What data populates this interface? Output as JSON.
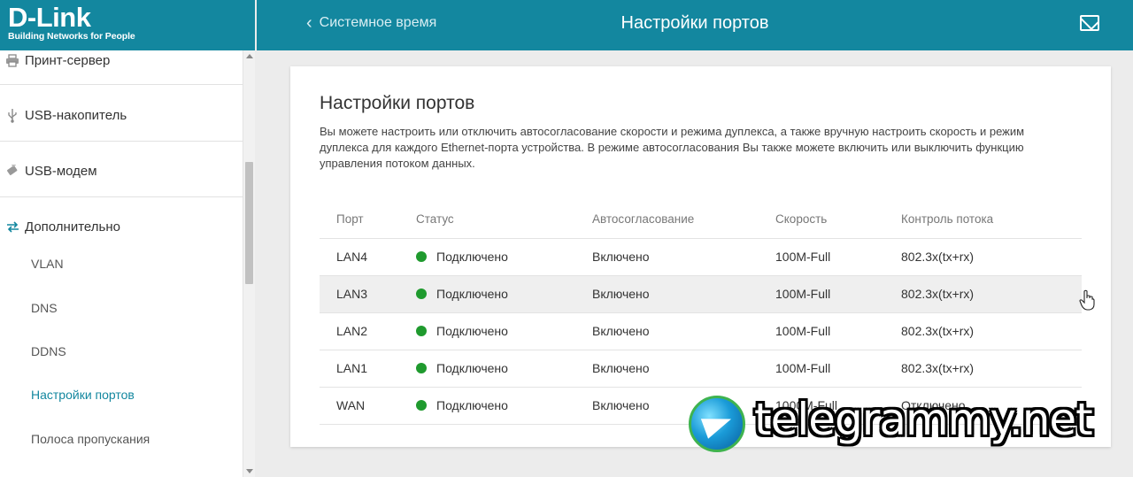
{
  "brand": {
    "name": "D-Link",
    "tagline": "Building Networks for People"
  },
  "header": {
    "back_label": "Системное время",
    "title": "Настройки портов"
  },
  "sidebar": {
    "items": [
      {
        "label": "Принт-сервер",
        "icon": "printer-icon"
      },
      {
        "label": "USB-накопитель",
        "icon": "usb-icon"
      },
      {
        "label": "USB-модем",
        "icon": "usb-modem-icon"
      },
      {
        "label": "Дополнительно",
        "icon": "arrows-icon"
      }
    ],
    "subitems": [
      "VLAN",
      "DNS",
      "DDNS",
      "Настройки портов",
      "Полоса пропускания"
    ],
    "active_subitem": "Настройки портов"
  },
  "main": {
    "title": "Настройки портов",
    "description": "Вы можете настроить или отключить автосогласование скорости и режима дуплекса, а также вручную настроить скорость и режим дуплекса для каждого Ethernet-порта устройства. В режиме автосогласования Вы также можете включить или выключить функцию управления потоком данных.",
    "table": {
      "headers": [
        "Порт",
        "Статус",
        "Автосогласование",
        "Скорость",
        "Контроль потока"
      ],
      "rows": [
        {
          "port": "LAN4",
          "status": "Подключено",
          "auto": "Включено",
          "speed": "100M-Full",
          "flow": "802.3x(tx+rx)"
        },
        {
          "port": "LAN3",
          "status": "Подключено",
          "auto": "Включено",
          "speed": "100M-Full",
          "flow": "802.3x(tx+rx)"
        },
        {
          "port": "LAN2",
          "status": "Подключено",
          "auto": "Включено",
          "speed": "100M-Full",
          "flow": "802.3x(tx+rx)"
        },
        {
          "port": "LAN1",
          "status": "Подключено",
          "auto": "Включено",
          "speed": "100M-Full",
          "flow": "802.3x(tx+rx)"
        },
        {
          "port": "WAN",
          "status": "Подключено",
          "auto": "Включено",
          "speed": "1000M-Full",
          "flow": "Отключено"
        }
      ]
    }
  },
  "watermark": {
    "text": "telegrammy.net"
  },
  "colors": {
    "brand": "#13879f",
    "status_ok": "#1f9a2e",
    "active_link": "#13879f"
  }
}
